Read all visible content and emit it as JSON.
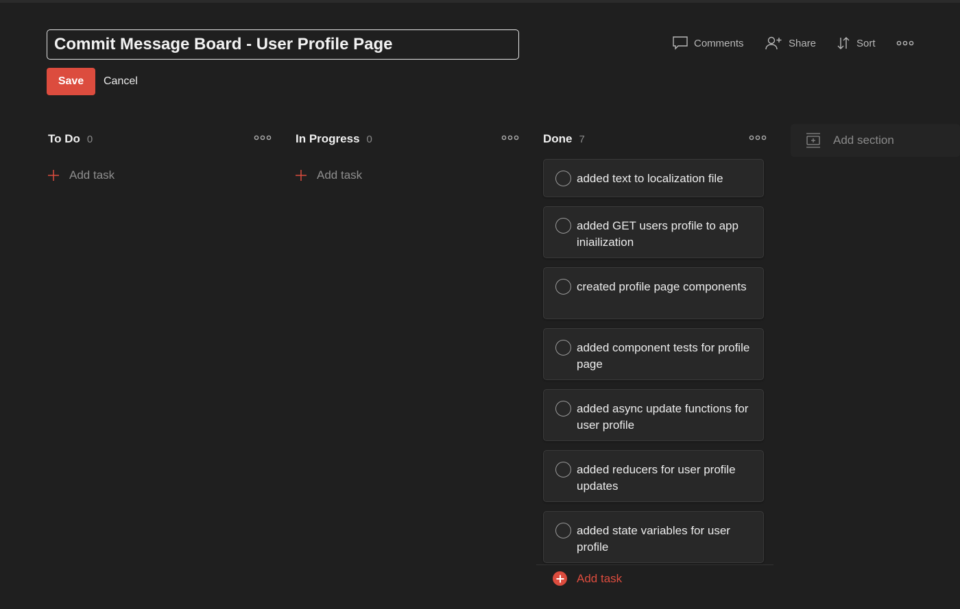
{
  "header": {
    "title_value": "Commit Message Board - User Profile Page",
    "save_label": "Save",
    "cancel_label": "Cancel"
  },
  "toolbar": {
    "comments_label": "Comments",
    "share_label": "Share",
    "sort_label": "Sort"
  },
  "columns": [
    {
      "title": "To Do",
      "count": "0",
      "add_task_label": "Add task"
    },
    {
      "title": "In Progress",
      "count": "0",
      "add_task_label": "Add task"
    },
    {
      "title": "Done",
      "count": "7",
      "add_task_label": "Add task",
      "tasks": [
        "added text to localization file",
        "added GET users profile to app iniailization",
        "created profile page components",
        "added component tests for profile page",
        "added async update functions for user profile",
        "added reducers for user profile updates",
        "added state variables for user profile"
      ]
    }
  ],
  "add_section_label": "Add section",
  "colors": {
    "background": "#1f1f1f",
    "accent": "#dc4c3e",
    "card": "#282828"
  },
  "icons": [
    "comment-icon",
    "add-person-icon",
    "sort-icon",
    "more-icon",
    "plus-icon",
    "add-section-icon",
    "checkbox-circle-icon"
  ]
}
